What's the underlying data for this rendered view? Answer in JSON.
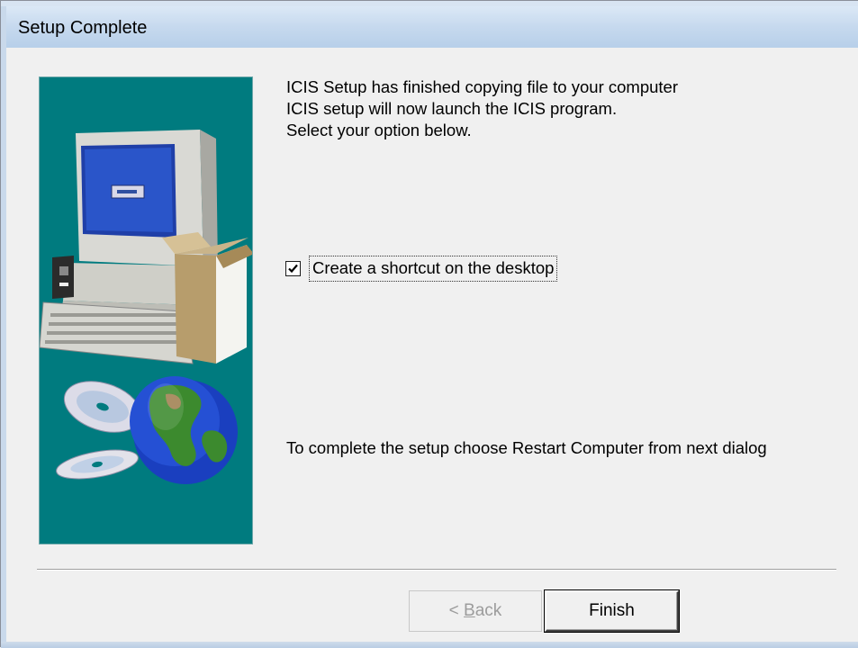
{
  "window": {
    "title": "Setup Complete"
  },
  "message": {
    "line1": "ICIS Setup has finished copying file to your computer",
    "line2": "ICIS setup will now launch the ICIS program.",
    "line3": "Select your option below."
  },
  "shortcut_option": {
    "label": "Create a shortcut on the desktop",
    "checked": true
  },
  "restart_message": "To complete the setup choose Restart Computer from next dialog",
  "buttons": {
    "back_prefix": "< ",
    "back_accel": "B",
    "back_rest": "ack",
    "back_enabled": false,
    "finish": "Finish"
  },
  "illustration": {
    "icons": [
      "computer-icon",
      "open-box-icon",
      "cd-disc-icon",
      "globe-icon"
    ],
    "background_color": "#007b7f"
  }
}
